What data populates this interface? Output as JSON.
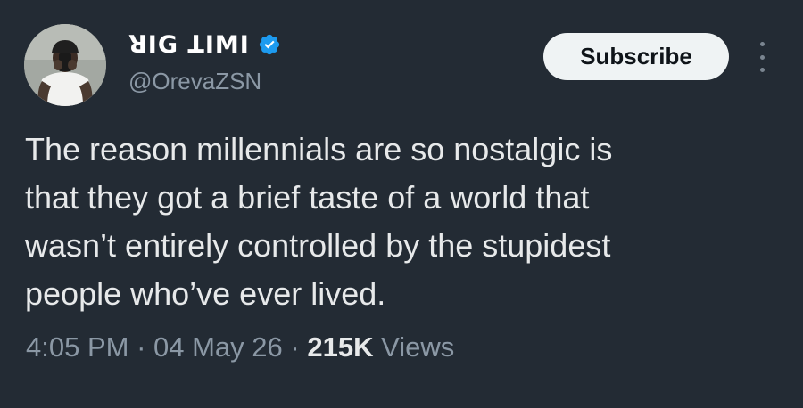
{
  "author": {
    "display_name": "ꓤIG ꓕIMI",
    "handle": "@OrevaZSN",
    "verified": true
  },
  "actions": {
    "subscribe_label": "Subscribe"
  },
  "tweet": {
    "text_lines": [
      "The reason millennials are so nostalgic is",
      "that they got a brief taste of a world that",
      "wasn’t entirely controlled by the stupidest",
      "people who’ve ever lived."
    ],
    "time": "4:05 PM",
    "separator": " · ",
    "date": "04 May 26",
    "views_count": "215K",
    "views_label": "Views"
  },
  "icons": {
    "verified": "verified-badge-icon",
    "more": "more-vertical-icon"
  },
  "colors": {
    "background": "#232b34",
    "verified": "#1d9bf0",
    "muted_text": "#8b98a5",
    "primary_text": "#e7e9ea",
    "subscribe_bg": "#eff3f4"
  }
}
